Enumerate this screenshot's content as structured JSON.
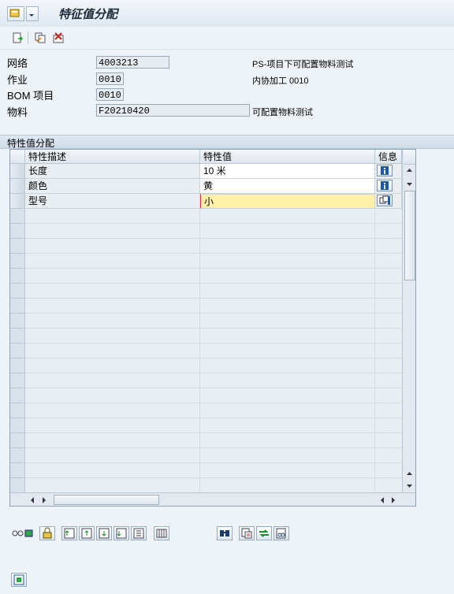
{
  "window": {
    "title": "特征值分配"
  },
  "toolbar": {
    "icons": [
      "new-document-icon",
      "copy-icon",
      "delete-icon"
    ]
  },
  "header": {
    "network": {
      "label": "网络",
      "value": "4003213",
      "description": "PS-项目下可配置物料测试"
    },
    "operation": {
      "label": "作业",
      "value": "0010",
      "description": "内协加工 0010"
    },
    "bom_item": {
      "label": "BOM 项目",
      "value": "0010"
    },
    "material": {
      "label": "物料",
      "value": "F20210420",
      "description": "可配置物料测试"
    }
  },
  "section": {
    "title": "特性值分配"
  },
  "table": {
    "columns": [
      "特性描述",
      "特性值",
      "信息"
    ],
    "rows": [
      {
        "description": "长度",
        "value": "10 米",
        "info_icon": "info-icon"
      },
      {
        "description": "颜色",
        "value": "黄",
        "info_icon": "info-icon"
      },
      {
        "description": "型号",
        "value": "小",
        "info_icon": "value-help-icon"
      }
    ],
    "empty_rows": 19,
    "selected_row_color": "#fff0a8"
  },
  "bottom_toolbar": {
    "group1": [
      "view-toggle-icon",
      "lock-icon",
      "sort-icon-1",
      "sort-icon-2",
      "sort-icon-3",
      "sort-icon-4",
      "sort-icon-5",
      "columns-icon"
    ],
    "group2": [
      "find-icon",
      "filter-icon",
      "refresh-icon",
      "find-next-icon"
    ]
  },
  "footer": {
    "icon": "display-icon"
  }
}
